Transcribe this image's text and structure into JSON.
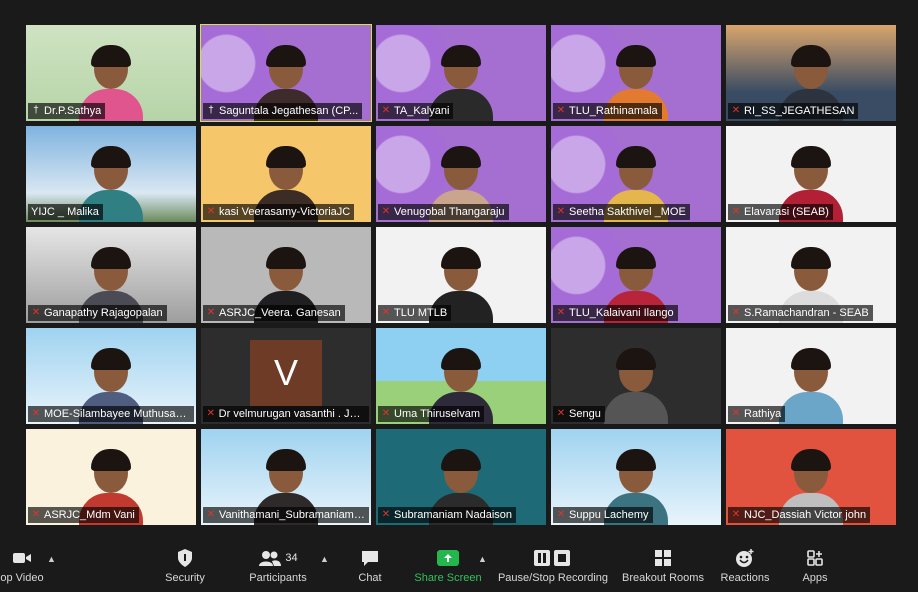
{
  "participants": [
    {
      "name": "Dr.P.Sathya",
      "icon": "pin-icon",
      "bg": "green",
      "shirt": "#e1558f"
    },
    {
      "name": "Saguntala Jegathesan (CP...",
      "icon": "pin-icon",
      "bg": "purple",
      "shirt": "#3d2a2a",
      "active": true
    },
    {
      "name": "TA_Kalyani",
      "icon": "mic-off-icon",
      "bg": "purple",
      "shirt": "#2a2a2a"
    },
    {
      "name": "TLU_Rathinamala",
      "icon": "mic-off-icon",
      "bg": "purple",
      "shirt": "#e27b2f"
    },
    {
      "name": "RI_SS_JEGATHESAN",
      "icon": "mic-off-icon",
      "bg": "sunset",
      "shirt": "#2d3440"
    },
    {
      "name": "YIJC _ Malika",
      "icon": "",
      "bg": "sky",
      "shirt": "#2f7f83"
    },
    {
      "name": "kasi Veerasamy-VictoriaJC",
      "icon": "mic-off-icon",
      "bg": "orange",
      "shirt": "#3b2c25"
    },
    {
      "name": "Venugobal Thangaraju",
      "icon": "mic-off-icon",
      "bg": "purple",
      "shirt": "#caa58d"
    },
    {
      "name": "Seetha Sakthivel _MOE",
      "icon": "mic-off-icon",
      "bg": "purple",
      "shirt": "#e4b64b"
    },
    {
      "name": "Elavarasi (SEAB)",
      "icon": "mic-off-icon",
      "bg": "white",
      "shirt": "#b22036"
    },
    {
      "name": "Ganapathy Rajagopalan",
      "icon": "mic-off-icon",
      "bg": "office",
      "shirt": "#4b4b55"
    },
    {
      "name": "ASRJC_Veera. Ganesan",
      "icon": "mic-off-icon",
      "bg": "gray",
      "shirt": "#1f1f22"
    },
    {
      "name": "TLU MTLB",
      "icon": "mic-off-icon",
      "bg": "white",
      "shirt": "#222222"
    },
    {
      "name": "TLU_Kalaivani Ilango",
      "icon": "mic-off-icon",
      "bg": "purple",
      "shirt": "#b8243a"
    },
    {
      "name": "S.Ramachandran - SEAB",
      "icon": "mic-off-icon",
      "bg": "white",
      "shirt": "#dcdcdc"
    },
    {
      "name": "MOE-Silambayee Muthusamy",
      "icon": "mic-off-icon",
      "bg": "blue",
      "shirt": "#4f5d80"
    },
    {
      "name": "Dr velmurugan vasanthi . JPJC",
      "icon": "mic-off-icon",
      "bg": "dark",
      "avatar": "V"
    },
    {
      "name": "Uma Thiruselvam",
      "icon": "mic-off-icon",
      "bg": "cartoon",
      "shirt": "#2f2a3a"
    },
    {
      "name": "Sengu",
      "icon": "mic-off-icon",
      "bg": "dark",
      "shirt": "#555555"
    },
    {
      "name": "Rathiya",
      "icon": "mic-off-icon",
      "bg": "white",
      "shirt": "#6ba6c9"
    },
    {
      "name": "ASRJC_Mdm Vani",
      "icon": "mic-off-icon",
      "bg": "cream",
      "shirt": "#c23a2f"
    },
    {
      "name": "Vanithamani_Subramaniam ...",
      "icon": "mic-off-icon",
      "bg": "blue",
      "shirt": "#2e2a2a"
    },
    {
      "name": "Subramaniam Nadaison",
      "icon": "mic-off-icon",
      "bg": "teal",
      "shirt": "#2b2b2b"
    },
    {
      "name": "Suppu Lachemy",
      "icon": "mic-off-icon",
      "bg": "blue",
      "shirt": "#3b7380"
    },
    {
      "name": "NJC_Dassiah Victor john",
      "icon": "mic-off-icon",
      "bg": "red",
      "shirt": "#bfbfbf"
    }
  ],
  "toolbar": {
    "video_label": "op Video",
    "security_label": "Security",
    "participants_label": "Participants",
    "participants_count": "34",
    "chat_label": "Chat",
    "share_label": "Share Screen",
    "recording_label": "Pause/Stop Recording",
    "breakout_label": "Breakout Rooms",
    "reactions_label": "Reactions",
    "apps_label": "Apps"
  },
  "colors": {
    "active_speaker": "#d6e14a",
    "share_green": "#22b84d",
    "mic_muted_red": "#e0352b"
  }
}
